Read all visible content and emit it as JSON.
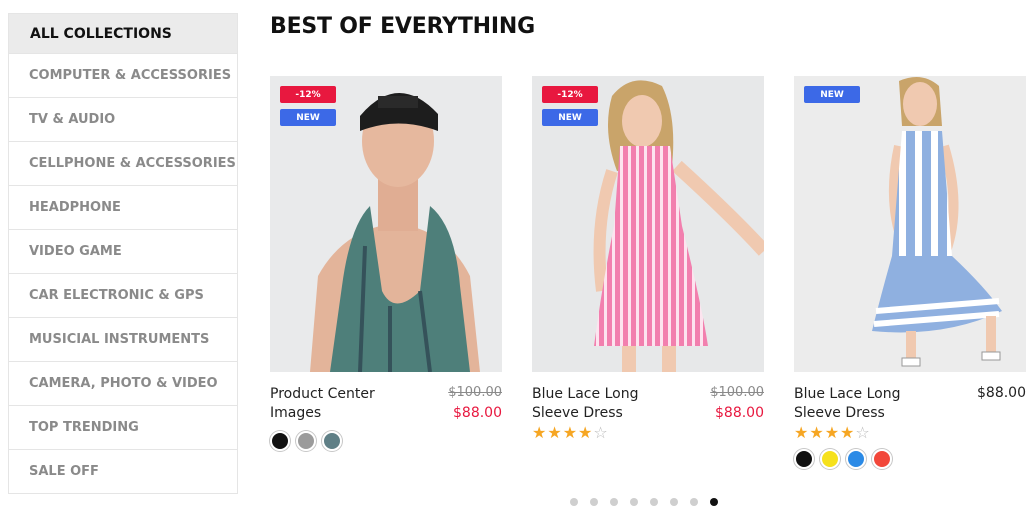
{
  "sidebar": {
    "header": "ALL COLLECTIONS",
    "items": [
      {
        "label": "COMPUTER & ACCESSORIES"
      },
      {
        "label": "TV & AUDIO"
      },
      {
        "label": "CELLPHONE & ACCESSORIES"
      },
      {
        "label": "HEADPHONE"
      },
      {
        "label": "VIDEO GAME"
      },
      {
        "label": "CAR ELECTRONIC & GPS"
      },
      {
        "label": "MUSICIAL INSTRUMENTS"
      },
      {
        "label": "CAMERA, PHOTO & VIDEO"
      },
      {
        "label": "TOP TRENDING"
      },
      {
        "label": "SALE OFF"
      }
    ]
  },
  "section": {
    "title": "BEST OF EVERYTHING"
  },
  "products": [
    {
      "title": "Product Center Images",
      "sale_badge": "-12%",
      "new_badge": "NEW",
      "old_price": "$100.00",
      "price": "$88.00",
      "rating": 0,
      "swatches": [
        "#111111",
        "#9b9b9b",
        "#5f7f86"
      ]
    },
    {
      "title": "Blue Lace Long Sleeve Dress",
      "sale_badge": "-12%",
      "new_badge": "NEW",
      "old_price": "$100.00",
      "price": "$88.00",
      "rating": 4,
      "rating_max": 5,
      "swatches": []
    },
    {
      "title": "Blue Lace Long Sleeve Dress",
      "new_badge": "NEW",
      "price": "$88.00",
      "rating": 4,
      "rating_max": 5,
      "swatches": [
        "#111111",
        "#f6e11c",
        "#2b8ae6",
        "#f2473a"
      ]
    }
  ],
  "carousel": {
    "pages": 8,
    "active": 8
  },
  "colors": {
    "sale": "#e8183f",
    "new": "#3c69e7",
    "star": "#f6a623"
  }
}
